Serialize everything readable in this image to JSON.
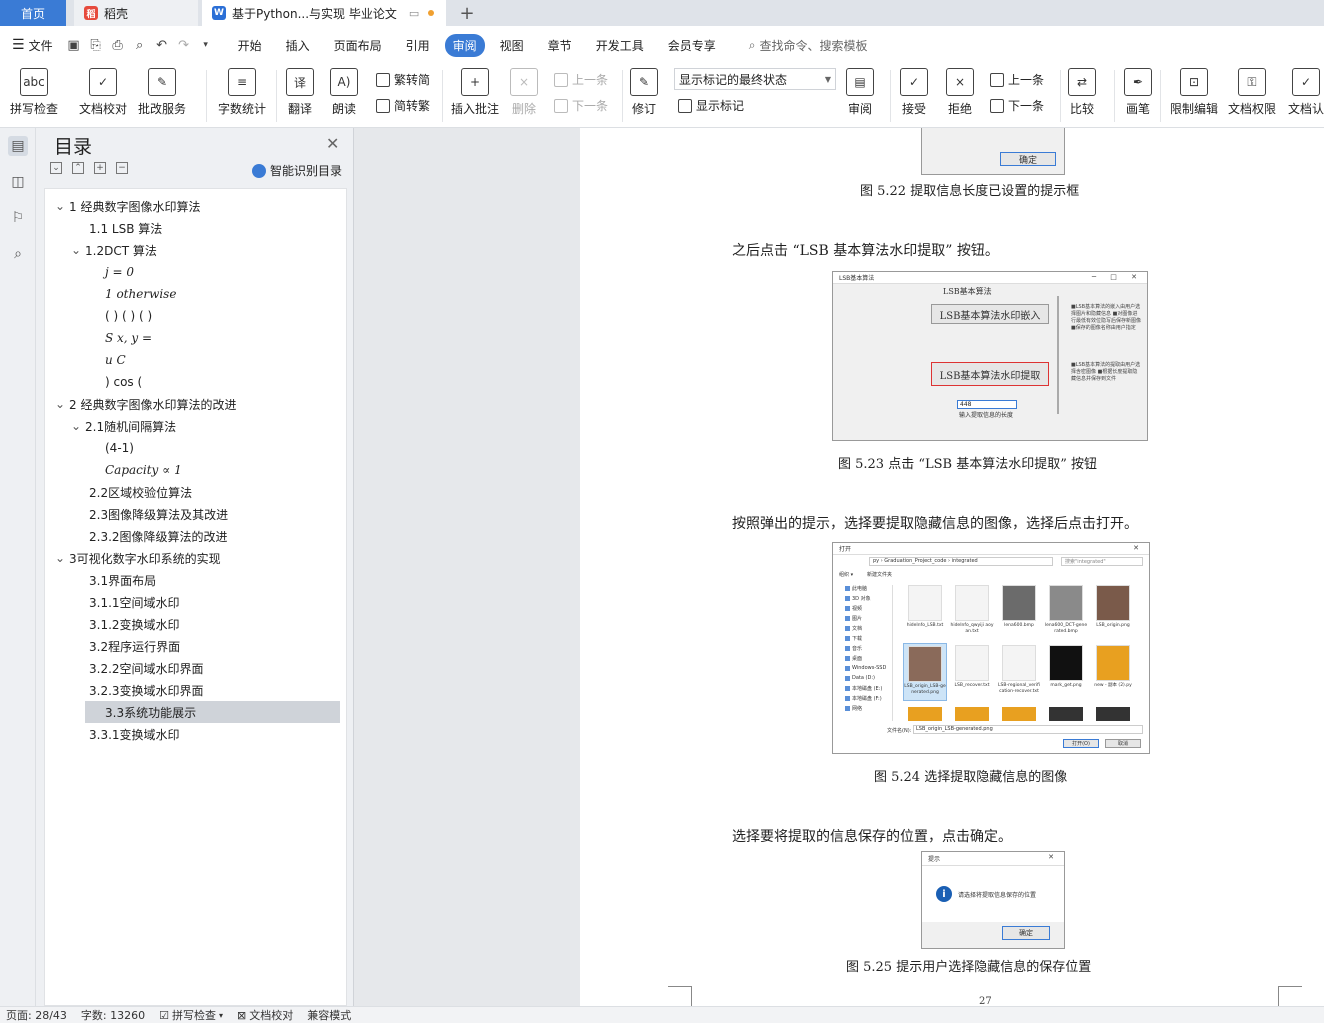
{
  "tabs": {
    "home": "首页",
    "doc1": {
      "icon": "daoke-icon",
      "label": "稻壳"
    },
    "doc2": {
      "icon": "wps-writer-icon",
      "label": "基于Python...与实现 毕业论文"
    }
  },
  "menubar": {
    "file": "文件",
    "items": [
      "开始",
      "插入",
      "页面布局",
      "引用",
      "审阅",
      "视图",
      "章节",
      "开发工具",
      "会员专享"
    ],
    "active": "审阅",
    "search": "查找命令、搜索模板"
  },
  "ribbon": {
    "spellcheck": "拼写检查",
    "doc_check": "文档校对",
    "review_service": "批改服务",
    "word_count": "字数统计",
    "translate": "翻译",
    "read_aloud": "朗读",
    "to_traditional": "繁转简",
    "to_simplified": "简转繁",
    "insert_comment": "插入批注",
    "delete": "删除",
    "prev": "上一条",
    "next": "下一条",
    "track_changes": "修订",
    "markup_dropdown": "显示标记的最终状态",
    "show_markup": "显示标记",
    "review_pane": "审阅",
    "accept": "接受",
    "reject": "拒绝",
    "prev_change": "上一条",
    "next_change": "下一条",
    "compare": "比较",
    "ink": "画笔",
    "restrict_edit": "限制编辑",
    "doc_permission": "文档权限",
    "doc_cert": "文档认"
  },
  "toc": {
    "title": "目录",
    "smart": "智能识别目录",
    "items": [
      {
        "text": "1 经典数字图像水印算法",
        "level": 1,
        "expanded": true
      },
      {
        "text": "1.1 LSB 算法",
        "level": 2
      },
      {
        "text": "1.2DCT 算法",
        "level": 2,
        "expanded": true
      },
      {
        "text": "j = 0",
        "level": 3,
        "math": true
      },
      {
        "text": "1 otherwise",
        "level": 3,
        "math": true
      },
      {
        "text": "( ) ( ) ( )",
        "level": 3
      },
      {
        "text": "S x, y =",
        "level": 3,
        "math": true
      },
      {
        "text": "u C",
        "level": 3,
        "math": true
      },
      {
        "text": ") cos (",
        "level": 3
      },
      {
        "text": "2 经典数字图像水印算法的改进",
        "level": 1,
        "expanded": true
      },
      {
        "text": "2.1随机间隔算法",
        "level": 2,
        "expanded": true
      },
      {
        "text": "(4-1)",
        "level": 3
      },
      {
        "text": "Capacity ∝ 1",
        "level": 3,
        "math": true
      },
      {
        "text": "2.2区域校验位算法",
        "level": 2
      },
      {
        "text": "2.3图像降级算法及其改进",
        "level": 2
      },
      {
        "text": "2.3.2图像降级算法的改进",
        "level": 2
      },
      {
        "text": "3可视化数字水印系统的实现",
        "level": 1,
        "expanded": true
      },
      {
        "text": "3.1界面布局",
        "level": 2
      },
      {
        "text": "3.1.1空间域水印",
        "level": 2
      },
      {
        "text": "3.1.2变换域水印",
        "level": 2
      },
      {
        "text": "3.2程序运行界面",
        "level": 2
      },
      {
        "text": "3.2.2空间域水印界面",
        "level": 2
      },
      {
        "text": "3.2.3变换域水印界面",
        "level": 2
      },
      {
        "text": "3.3系统功能展示",
        "level": 2,
        "selected": true
      },
      {
        "text": "3.3.1变换域水印",
        "level": 2
      }
    ]
  },
  "document": {
    "fig522_btn": "确定",
    "cap522": "图 5.22   提取信息长度已设置的提示框",
    "para1": "之后点击 “LSB 基本算法水印提取” 按钮。",
    "fig523": {
      "window_title": "LSB基本算法",
      "heading": "LSB基本算法",
      "embed_btn": "LSB基本算法水印嵌入",
      "extract_btn": "LSB基本算法水印提取",
      "input_value": "448",
      "input_hint": "输入提取信息的长度",
      "notes1": "■LSB基本算法的嵌入由用户选择图片和隐藏信息 ■对图像进行最低有效位隐写后保存新图像 ■保存的图像名称由用户指定",
      "notes2": "■LSB基本算法的提取由用户选择含密图像 ■根据长度提取隐藏信息并保存到文件"
    },
    "cap523": "图 5.23   点击 “LSB 基本算法水印提取” 按钮",
    "para2": "按照弹出的提示，选择要提取隐藏信息的图像，选择后点击打开。",
    "fig524": {
      "window_title": "打开",
      "path": "py › Graduation_Project_code › integrated",
      "search": "搜索\"integrated\"",
      "organize": "组织 ▾",
      "new_folder": "新建文件夹",
      "sidebar": [
        "此电脑",
        "3D 对象",
        "视频",
        "图片",
        "文档",
        "下载",
        "音乐",
        "桌面",
        "Windows-SSD",
        "Data (D:)",
        "本地磁盘 (E:)",
        "本地磁盘 (F:)",
        "网络"
      ],
      "files": [
        "hideInfo_LSB.txt",
        "hideInfo_qwyiji aoyan.txt",
        "lena600.bmp",
        "lena600_DCT-generated.bmp",
        "LSB_origin.png",
        "LSB_origin_LSB-generated.png",
        "LSB_recover.txt",
        "LSB-regional_verification-recover.txt",
        "mark_get.png",
        "new - 副本 (2).py"
      ],
      "filename_label": "文件名(N):",
      "filename": "LSB_origin_LSB-generated.png",
      "open_btn": "打开(O)",
      "cancel_btn": "取消"
    },
    "cap524": "图 5.24   选择提取隐藏信息的图像",
    "para3": "选择要将提取的信息保存的位置，点击确定。",
    "fig525": {
      "window_title": "提示",
      "message": "请选择将提取信息保存的位置",
      "ok": "确定"
    },
    "cap525": "图 5.25   提示用户选择隐藏信息的保存位置",
    "page_number": "27"
  },
  "statusbar": {
    "page": "页面: 28/43",
    "words": "字数: 13260",
    "spell": "拼写检查",
    "check": "文档校对",
    "mode": "兼容模式"
  },
  "colors": {
    "accent": "#3a7bd5",
    "selected_row": "#cfd3d9",
    "highlight_red": "#d33"
  }
}
